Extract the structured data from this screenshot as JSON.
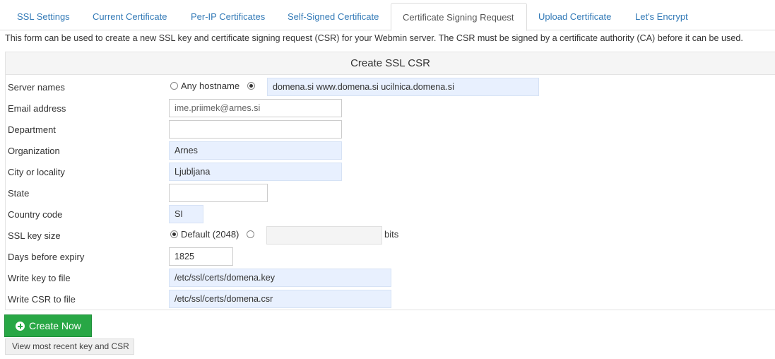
{
  "tabs": [
    {
      "label": "SSL Settings"
    },
    {
      "label": "Current Certificate"
    },
    {
      "label": "Per-IP Certificates"
    },
    {
      "label": "Self-Signed Certificate"
    },
    {
      "label": "Certificate Signing Request"
    },
    {
      "label": "Upload Certificate"
    },
    {
      "label": "Let's Encrypt"
    }
  ],
  "active_tab": "Certificate Signing Request",
  "intro": "This form can be used to create a new SSL key and certificate signing request (CSR) for your Webmin server. The CSR must be signed by a certificate authority (CA) before it can be used.",
  "form": {
    "title": "Create SSL CSR",
    "server_names": {
      "label": "Server names",
      "any_hostname_label": "Any hostname",
      "selected": "custom",
      "value": "domena.si www.domena.si ucilnica.domena.si"
    },
    "email": {
      "label": "Email address",
      "value": "ime.priimek@arnes.si"
    },
    "department": {
      "label": "Department",
      "value": ""
    },
    "organization": {
      "label": "Organization",
      "value": "Arnes"
    },
    "city": {
      "label": "City or locality",
      "value": "Ljubljana"
    },
    "state": {
      "label": "State",
      "value": ""
    },
    "country": {
      "label": "Country code",
      "value": "SI"
    },
    "key_size": {
      "label": "SSL key size",
      "default_label": "Default (2048)",
      "selected": "default",
      "value": "",
      "unit": "bits"
    },
    "days": {
      "label": "Days before expiry",
      "value": "1825"
    },
    "key_file": {
      "label": "Write key to file",
      "value": "/etc/ssl/certs/domena.key"
    },
    "csr_file": {
      "label": "Write CSR to file",
      "value": "/etc/ssl/certs/domena.csr"
    }
  },
  "buttons": {
    "create": "Create Now",
    "view": "View most recent key and CSR"
  },
  "colors": {
    "link": "#337ab7",
    "create_button": "#28a745",
    "autofill_bg": "#e8f0fe"
  }
}
